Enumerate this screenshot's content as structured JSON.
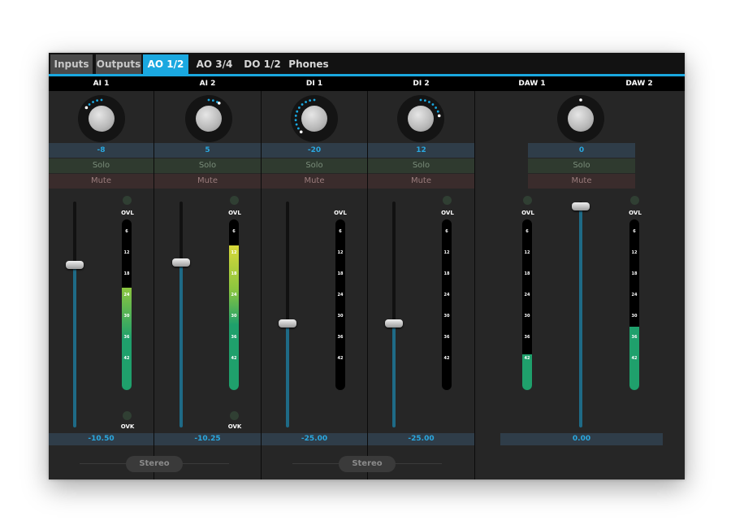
{
  "tabs": [
    {
      "label": "Inputs",
      "state": "inactive"
    },
    {
      "label": "Outputs",
      "state": "inactive"
    },
    {
      "label": "AO 1/2",
      "state": "active"
    },
    {
      "label": "AO 3/4",
      "state": "normal"
    },
    {
      "label": "DO 1/2",
      "state": "normal"
    },
    {
      "label": "Phones",
      "state": "normal"
    }
  ],
  "colors": {
    "accent": "#1aa8e0",
    "meter_green": "#1fa06c",
    "meter_yellow": "#d8d83a"
  },
  "channels": {
    "ai1": {
      "name": "AI 1",
      "gain": "-8",
      "solo": "Solo",
      "mute": "Mute",
      "fader_db": "-10.50",
      "fader_level": 0.72,
      "meter_level": 0.6,
      "ovl": "OVL",
      "ovk": "OVK"
    },
    "ai2": {
      "name": "AI 2",
      "gain": "5",
      "solo": "Solo",
      "mute": "Mute",
      "fader_db": "-10.25",
      "fader_level": 0.73,
      "meter_level": 0.85,
      "ovl": "OVL",
      "ovk": "OVK"
    },
    "di1": {
      "name": "DI 1",
      "gain": "-20",
      "solo": "Solo",
      "mute": "Mute",
      "fader_db": "-25.00",
      "fader_level": 0.46,
      "meter_level": 0,
      "ovl": "OVL"
    },
    "di2": {
      "name": "DI 2",
      "gain": "12",
      "solo": "Solo",
      "mute": "Mute",
      "fader_db": "-25.00",
      "fader_level": 0.46,
      "meter_level": 0,
      "ovl": "OVL"
    },
    "daw": {
      "name1": "DAW 1",
      "name2": "DAW 2",
      "gain": "0",
      "solo": "Solo",
      "mute": "Mute",
      "fader_db": "0.00",
      "fader_level": 0.98,
      "meter1_level": 0.21,
      "meter2_level": 0.37,
      "ovl": "OVL"
    }
  },
  "meter_ticks": [
    "6",
    "12",
    "18",
    "24",
    "30",
    "36",
    "42"
  ],
  "stereo_label": "Stereo"
}
